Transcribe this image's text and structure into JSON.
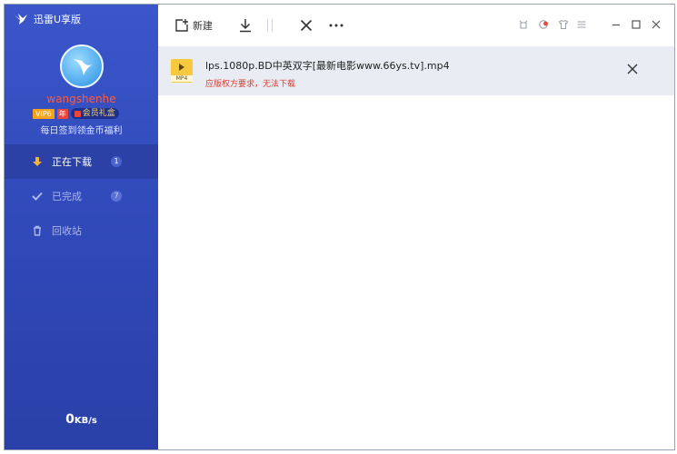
{
  "app": {
    "title": "迅雷U享版"
  },
  "user": {
    "name": "wangshenhe",
    "vip_badge": "VIP6",
    "year_badge": "年",
    "gift_label": "会员礼盒",
    "signin_text": "每日签到领金币福利"
  },
  "nav": {
    "items": [
      {
        "label": "正在下载",
        "count": "1",
        "icon": "download-arrow-icon"
      },
      {
        "label": "已完成",
        "count": "7",
        "icon": "checkmark-icon"
      },
      {
        "label": "回收站",
        "icon": "trash-icon"
      }
    ]
  },
  "speed": {
    "value": "0",
    "unit": "KB/s"
  },
  "toolbar": {
    "new_label": "新建"
  },
  "tasks": [
    {
      "filename": "lps.1080p.BD中英双字[最新电影www.66ys.tv].mp4",
      "file_type": "MP4",
      "status": "应版权方要求，无法下载"
    }
  ],
  "colors": {
    "sidebar": "#3048b8",
    "status_error": "#e0372c",
    "username": "#ff5a3c"
  }
}
